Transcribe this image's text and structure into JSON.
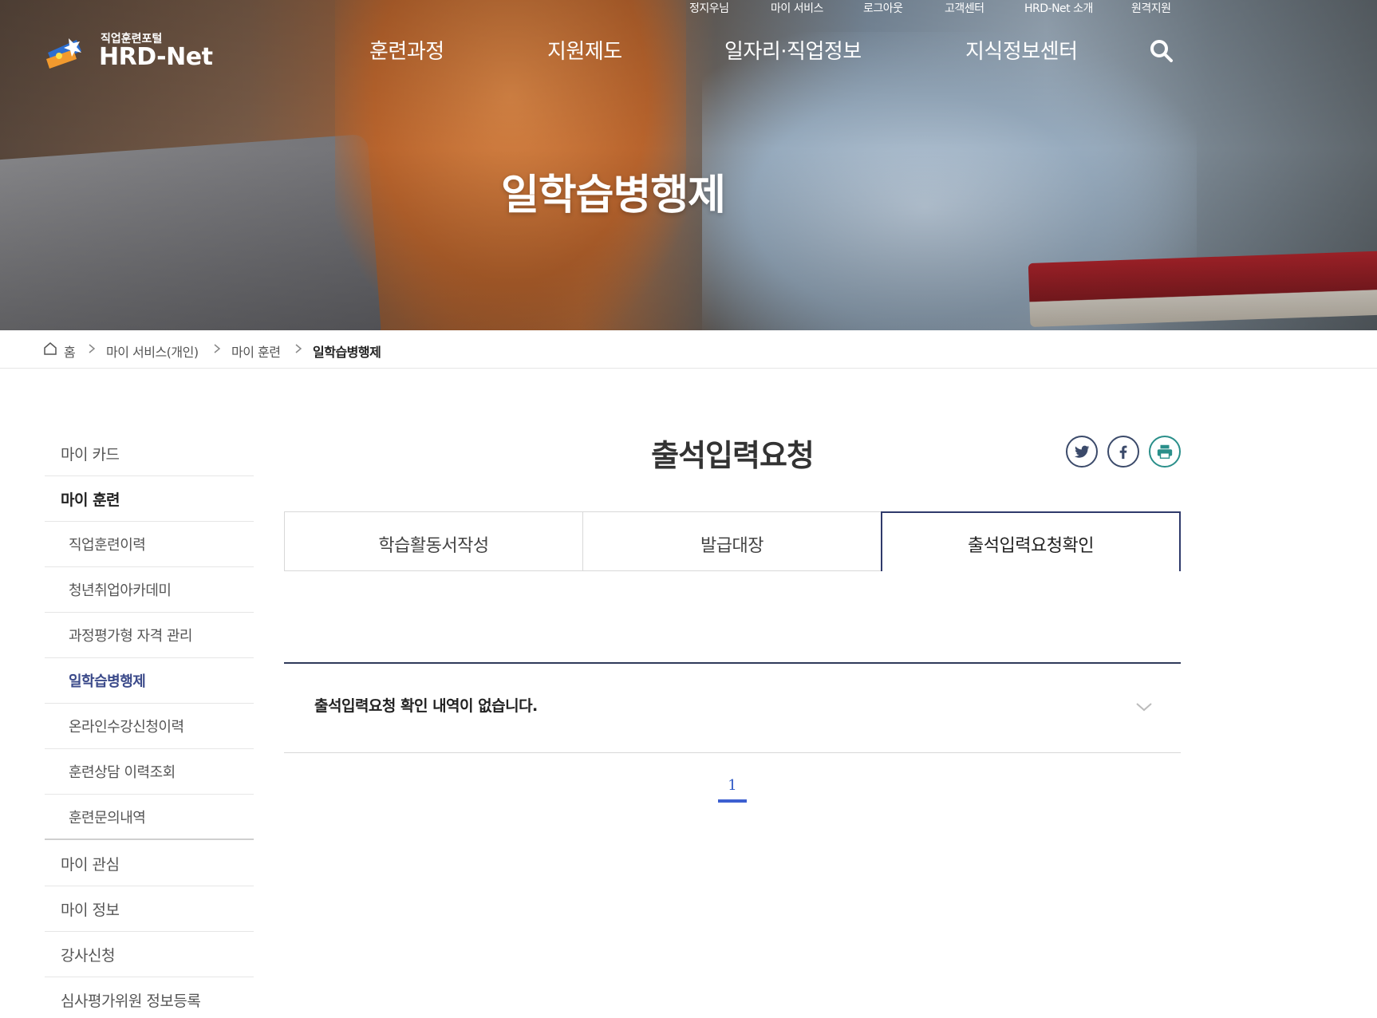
{
  "utility_links": [
    "정지우님",
    "마이 서비스",
    "로그아웃",
    "고객센터",
    "HRD-Net 소개",
    "원격지원"
  ],
  "logo": {
    "sub": "직업훈련포털",
    "brand": "HRD-Net"
  },
  "gnb": [
    "훈련과정",
    "지원제도",
    "일자리·직업정보",
    "지식정보센터"
  ],
  "hero": {
    "title": "일학습병행제"
  },
  "breadcrumb": [
    "홈",
    "마이 서비스(개인)",
    "마이 훈련",
    "일학습병행제"
  ],
  "sidebar": [
    {
      "label": "마이 카드",
      "depth": 1,
      "active": false
    },
    {
      "label": "마이 훈련",
      "depth": 1,
      "active": true
    },
    {
      "label": "직업훈련이력",
      "depth": 2,
      "active": false
    },
    {
      "label": "청년취업아카데미",
      "depth": 2,
      "active": false
    },
    {
      "label": "과정평가형 자격 관리",
      "depth": 2,
      "active": false
    },
    {
      "label": "일학습병행제",
      "depth": 2,
      "active": true
    },
    {
      "label": "온라인수강신청이력",
      "depth": 2,
      "active": false
    },
    {
      "label": "훈련상담 이력조회",
      "depth": 2,
      "active": false
    },
    {
      "label": "훈련문의내역",
      "depth": 2,
      "active": false
    },
    {
      "label": "마이 관심",
      "depth": 1,
      "active": false
    },
    {
      "label": "마이 정보",
      "depth": 1,
      "active": false
    },
    {
      "label": "강사신청",
      "depth": 1,
      "active": false
    },
    {
      "label": "심사평가위원 정보등록",
      "depth": 1,
      "active": false
    }
  ],
  "page": {
    "title": "출석입력요청"
  },
  "share": [
    "twitter-icon",
    "facebook-icon",
    "print-icon"
  ],
  "tabs": [
    {
      "label": "학습활동서작성",
      "active": false
    },
    {
      "label": "발급대장",
      "active": false
    },
    {
      "label": "출석입력요청확인",
      "active": true
    }
  ],
  "result": {
    "empty_message": "출석입력요청 확인 내역이 없습니다."
  },
  "pagination": {
    "current": "1"
  },
  "colors": {
    "accent": "#2f3a6b",
    "pagination": "#3c5fd0",
    "active_sidebar": "#3b4a8a"
  }
}
